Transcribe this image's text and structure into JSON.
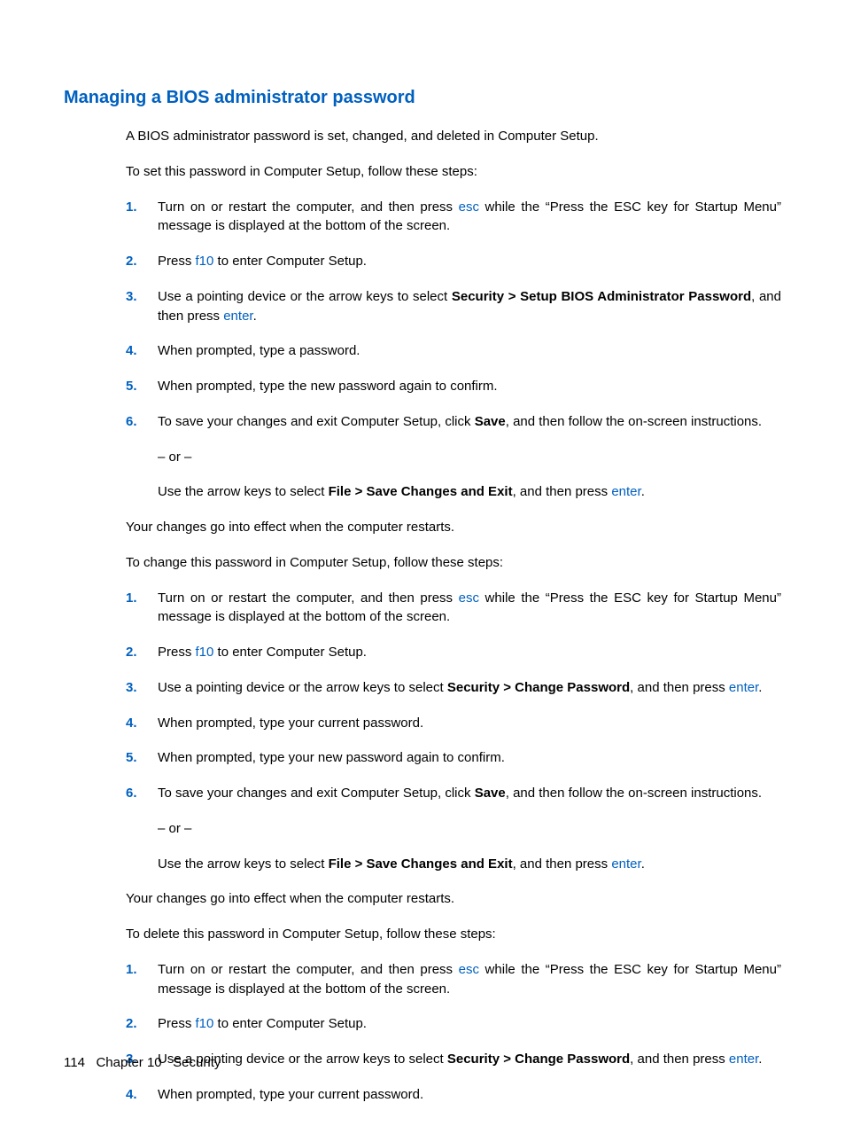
{
  "title": "Managing a BIOS administrator password",
  "intro": "A BIOS administrator password is set, changed, and deleted in Computer Setup.",
  "set_lead": "To set this password in Computer Setup, follow these steps:",
  "effect_para": "Your changes go into effect when the computer restarts.",
  "change_lead": "To change this password in Computer Setup, follow these steps:",
  "delete_lead": "To delete this password in Computer Setup, follow these steps:",
  "keys": {
    "esc": "esc",
    "f10": "f10",
    "enter": "enter"
  },
  "bold": {
    "sec_setup_bios": "Security > Setup BIOS Administrator Password",
    "sec_change": "Security > Change Password",
    "save": "Save",
    "file_save_exit": "File > Save Changes and Exit"
  },
  "steps_set": {
    "s1a": "Turn on or restart the computer, and then press ",
    "s1b": " while the “Press the ESC key for Startup Menu” message is displayed at the bottom of the screen.",
    "s2a": "Press ",
    "s2b": " to enter Computer Setup.",
    "s3a": "Use a pointing device or the arrow keys to select ",
    "s3b": ", and then press ",
    "s3c": ".",
    "s4": "When prompted, type a password.",
    "s5": "When prompted, type the new password again to confirm.",
    "s6a": "To save your changes and exit Computer Setup, click ",
    "s6b": ", and then follow the on-screen instructions.",
    "s6_or": "– or –",
    "s6c": "Use the arrow keys to select ",
    "s6d": ", and then press ",
    "s6e": "."
  },
  "steps_change": {
    "s4": "When prompted, type your current password.",
    "s5": "When prompted, type your new password again to confirm."
  },
  "footer": {
    "page": "114",
    "chapter": "Chapter 10",
    "name": "Security"
  }
}
